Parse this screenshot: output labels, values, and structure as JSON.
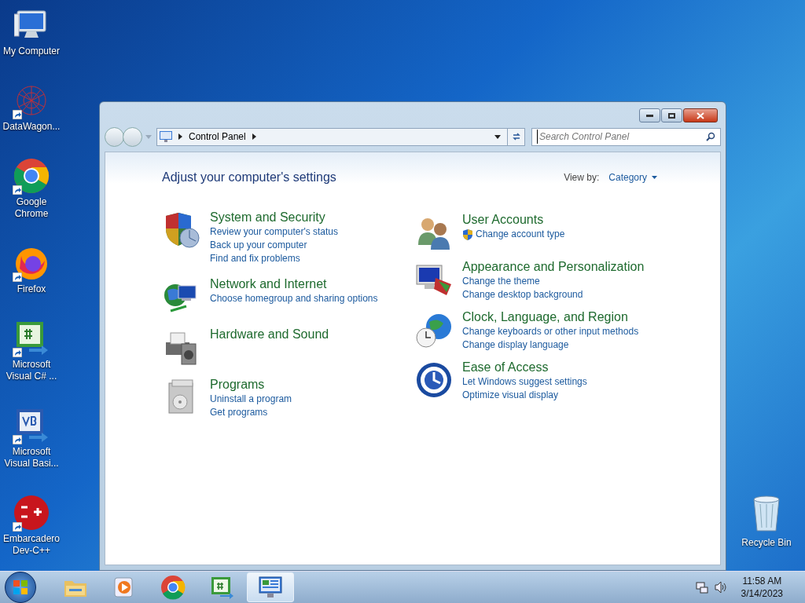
{
  "desktop_icons": [
    {
      "kind": "computer",
      "label": "My Computer",
      "shortcut": false
    },
    {
      "kind": "web",
      "label": "DataWagon...",
      "shortcut": true
    },
    {
      "kind": "chrome",
      "label": "Google Chrome",
      "shortcut": true
    },
    {
      "kind": "firefox",
      "label": "Firefox",
      "shortcut": true
    },
    {
      "kind": "csharp",
      "label": "Microsoft Visual C# ...",
      "shortcut": true
    },
    {
      "kind": "vb",
      "label": "Microsoft Visual Basi...",
      "shortcut": true
    },
    {
      "kind": "dev",
      "label": "Embarcadero Dev-C++",
      "shortcut": true
    }
  ],
  "recycle_bin": {
    "label": "Recycle Bin"
  },
  "window": {
    "address": {
      "crumb": "Control Panel"
    },
    "search": {
      "placeholder": "Search Control Panel"
    },
    "heading": "Adjust your computer's settings",
    "view_by": {
      "label": "View by:",
      "value": "Category"
    },
    "columns": [
      [
        {
          "kind": "security",
          "title": "System and Security",
          "links": [
            {
              "text": "Review your computer's status",
              "shield": false
            },
            {
              "text": "Back up your computer",
              "shield": false
            },
            {
              "text": "Find and fix problems",
              "shield": false
            }
          ]
        },
        {
          "kind": "network",
          "title": "Network and Internet",
          "links": [
            {
              "text": "Choose homegroup and sharing options",
              "shield": false
            }
          ]
        },
        {
          "kind": "hardware",
          "title": "Hardware and Sound"
        },
        {
          "kind": "programs",
          "title": "Programs",
          "links": [
            {
              "text": "Uninstall a program",
              "shield": false
            },
            {
              "text": "Get programs",
              "shield": false
            }
          ]
        }
      ],
      [
        {
          "kind": "users",
          "title": "User Accounts",
          "links": [
            {
              "text": "Change account type",
              "shield": true
            }
          ]
        },
        {
          "kind": "appearance",
          "title": "Appearance and Personalization",
          "links": [
            {
              "text": "Change the theme",
              "shield": false
            },
            {
              "text": "Change desktop background",
              "shield": false
            }
          ]
        },
        {
          "kind": "clock",
          "title": "Clock, Language, and Region",
          "links": [
            {
              "text": "Change keyboards or other input methods",
              "shield": false
            },
            {
              "text": "Change display language",
              "shield": false
            }
          ]
        },
        {
          "kind": "access",
          "title": "Ease of Access",
          "links": [
            {
              "text": "Let Windows suggest settings",
              "shield": false
            },
            {
              "text": "Optimize visual display",
              "shield": false
            }
          ]
        }
      ]
    ]
  },
  "taskbar": {
    "apps": [
      {
        "kind": "explorer",
        "selected": false
      },
      {
        "kind": "media",
        "selected": false
      },
      {
        "kind": "chrome",
        "selected": false
      },
      {
        "kind": "csharp",
        "selected": false
      },
      {
        "kind": "controlpanel",
        "selected": true
      }
    ],
    "time": "11:58 AM",
    "date": "3/14/2023"
  }
}
